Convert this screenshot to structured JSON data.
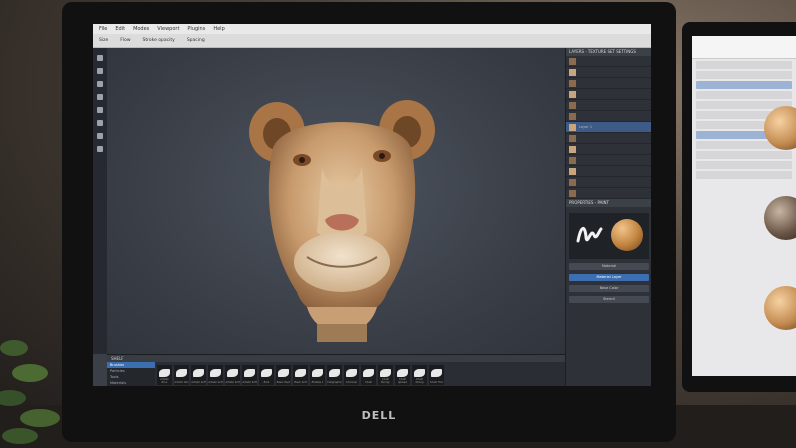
{
  "monitor_brand": "DELL",
  "app": {
    "menu": [
      "File",
      "Edit",
      "Modes",
      "Viewport",
      "Plugins",
      "Help"
    ],
    "toolbar": [
      "Size",
      "Flow",
      "Stroke opacity",
      "Spacing"
    ],
    "panels": {
      "layers_title": "LAYERS",
      "texture_set_title": "TEXTURE SET SETTINGS",
      "selected_layer": "Layer 1",
      "brush_panel_title": "PROPERTIES - PAINT",
      "buttons": [
        "Material",
        "Material Layer",
        "Base Color",
        "Stencil"
      ]
    },
    "shelf": {
      "title": "SHELF",
      "categories": [
        "Brushes",
        "Particles",
        "Tools",
        "Materials",
        "Smart materials"
      ],
      "selected_category": "Brushes",
      "brushes": [
        "Artistic Brus",
        "Artistic Pen",
        "Artistic Soft",
        "Artistic Soft",
        "Artistic Soft",
        "Artistic Soft",
        "Bark",
        "Basic Hard",
        "Basic Soft",
        "Bristles 1",
        "Calligraphic",
        "Charcoal",
        "Chalk",
        "Chalk Bumpy",
        "Chalk Spread",
        "Chalk Strong",
        "Chalk Thin"
      ]
    }
  },
  "colors": {
    "accent": "#3c6fb2",
    "viewport": "#3a3f48",
    "panel": "#2e3238"
  }
}
